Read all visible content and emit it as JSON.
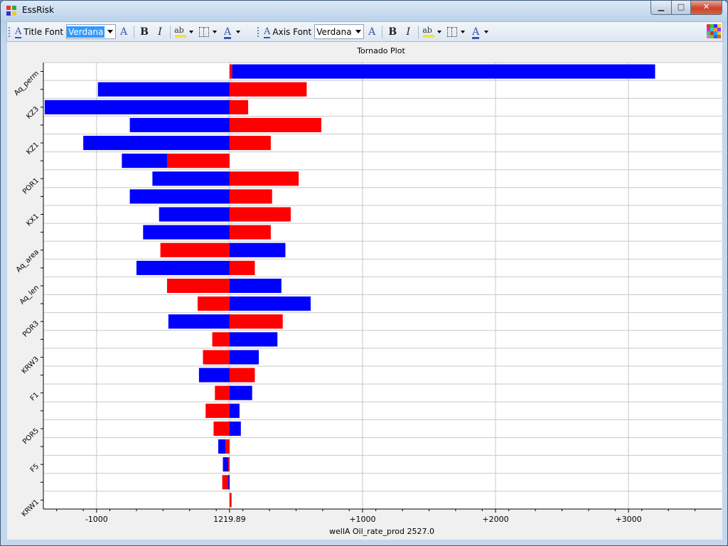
{
  "window": {
    "title": "EssRisk"
  },
  "toolbar": {
    "title_font": {
      "label": "Title Font",
      "value": "Verdana"
    },
    "axis_font": {
      "label": "Axis Font",
      "value": "Verdana"
    },
    "icons": [
      "font-size-icon",
      "bold-icon",
      "italic-icon",
      "highlight-color-icon",
      "border-icon",
      "font-color-icon",
      "color-palette-icon"
    ]
  },
  "colors": {
    "low": "#ff0000",
    "high": "#0000ff",
    "grid": "#c8c8c8"
  },
  "chart_data": {
    "type": "tornado",
    "title": "Tornado Plot",
    "xlabel": "wellA Oil_rate_prod 2527.0",
    "base_value": 1219.89,
    "center_tick_label": "1219.89",
    "xlim": [
      -1400,
      3700
    ],
    "x_ticks": [
      {
        "value": -1000,
        "label": "-1000"
      },
      {
        "value": 0,
        "label": "1219.89"
      },
      {
        "value": 1000,
        "label": "+1000"
      },
      {
        "value": 2000,
        "label": "+2000"
      },
      {
        "value": 3000,
        "label": "+3000"
      }
    ],
    "categories": [
      "Aq_perm",
      "",
      "KZ3",
      "",
      "KZ1",
      "",
      "POR1",
      "",
      "KX1",
      "",
      "Aq_area",
      "",
      "Aq_len",
      "",
      "POR3",
      "",
      "KRW3",
      "",
      "F1",
      "",
      "POR5",
      "",
      "F5",
      "",
      "KRW1"
    ],
    "bars": [
      {
        "red": [
          0,
          20
        ],
        "blue": [
          20,
          3200
        ]
      },
      {
        "red": [
          0,
          580
        ],
        "blue": [
          -990,
          0
        ]
      },
      {
        "red": [
          0,
          140
        ],
        "blue": [
          -1390,
          0
        ]
      },
      {
        "red": [
          0,
          690
        ],
        "blue": [
          -750,
          0
        ]
      },
      {
        "red": [
          0,
          310
        ],
        "blue": [
          -1100,
          0
        ]
      },
      {
        "red": [
          -470,
          0
        ],
        "blue": [
          -810,
          -470
        ]
      },
      {
        "red": [
          0,
          520
        ],
        "blue": [
          -580,
          0
        ]
      },
      {
        "red": [
          0,
          320
        ],
        "blue": [
          -750,
          0
        ]
      },
      {
        "red": [
          0,
          460
        ],
        "blue": [
          -530,
          0
        ]
      },
      {
        "red": [
          0,
          310
        ],
        "blue": [
          -650,
          0
        ]
      },
      {
        "red": [
          -520,
          0
        ],
        "blue": [
          0,
          420
        ]
      },
      {
        "red": [
          0,
          190
        ],
        "blue": [
          -700,
          0
        ]
      },
      {
        "red": [
          -470,
          0
        ],
        "blue": [
          0,
          390
        ]
      },
      {
        "red": [
          -240,
          0
        ],
        "blue": [
          0,
          610
        ]
      },
      {
        "red": [
          0,
          400
        ],
        "blue": [
          -460,
          0
        ]
      },
      {
        "red": [
          -130,
          0
        ],
        "blue": [
          0,
          360
        ]
      },
      {
        "red": [
          -200,
          0
        ],
        "blue": [
          0,
          220
        ]
      },
      {
        "red": [
          0,
          190
        ],
        "blue": [
          -230,
          0
        ]
      },
      {
        "red": [
          -110,
          0
        ],
        "blue": [
          0,
          170
        ]
      },
      {
        "red": [
          -180,
          0
        ],
        "blue": [
          0,
          75
        ]
      },
      {
        "red": [
          -120,
          0
        ],
        "blue": [
          0,
          85
        ]
      },
      {
        "red": [
          -30,
          0
        ],
        "blue": [
          -85,
          -30
        ]
      },
      {
        "red": [
          -10,
          0
        ],
        "blue": [
          -50,
          -10
        ]
      },
      {
        "red": [
          -55,
          0
        ],
        "blue": [
          -10,
          0
        ]
      },
      {
        "red": [
          0,
          15
        ],
        "blue": [
          0,
          0
        ]
      }
    ],
    "grid": true,
    "legend": "none"
  }
}
